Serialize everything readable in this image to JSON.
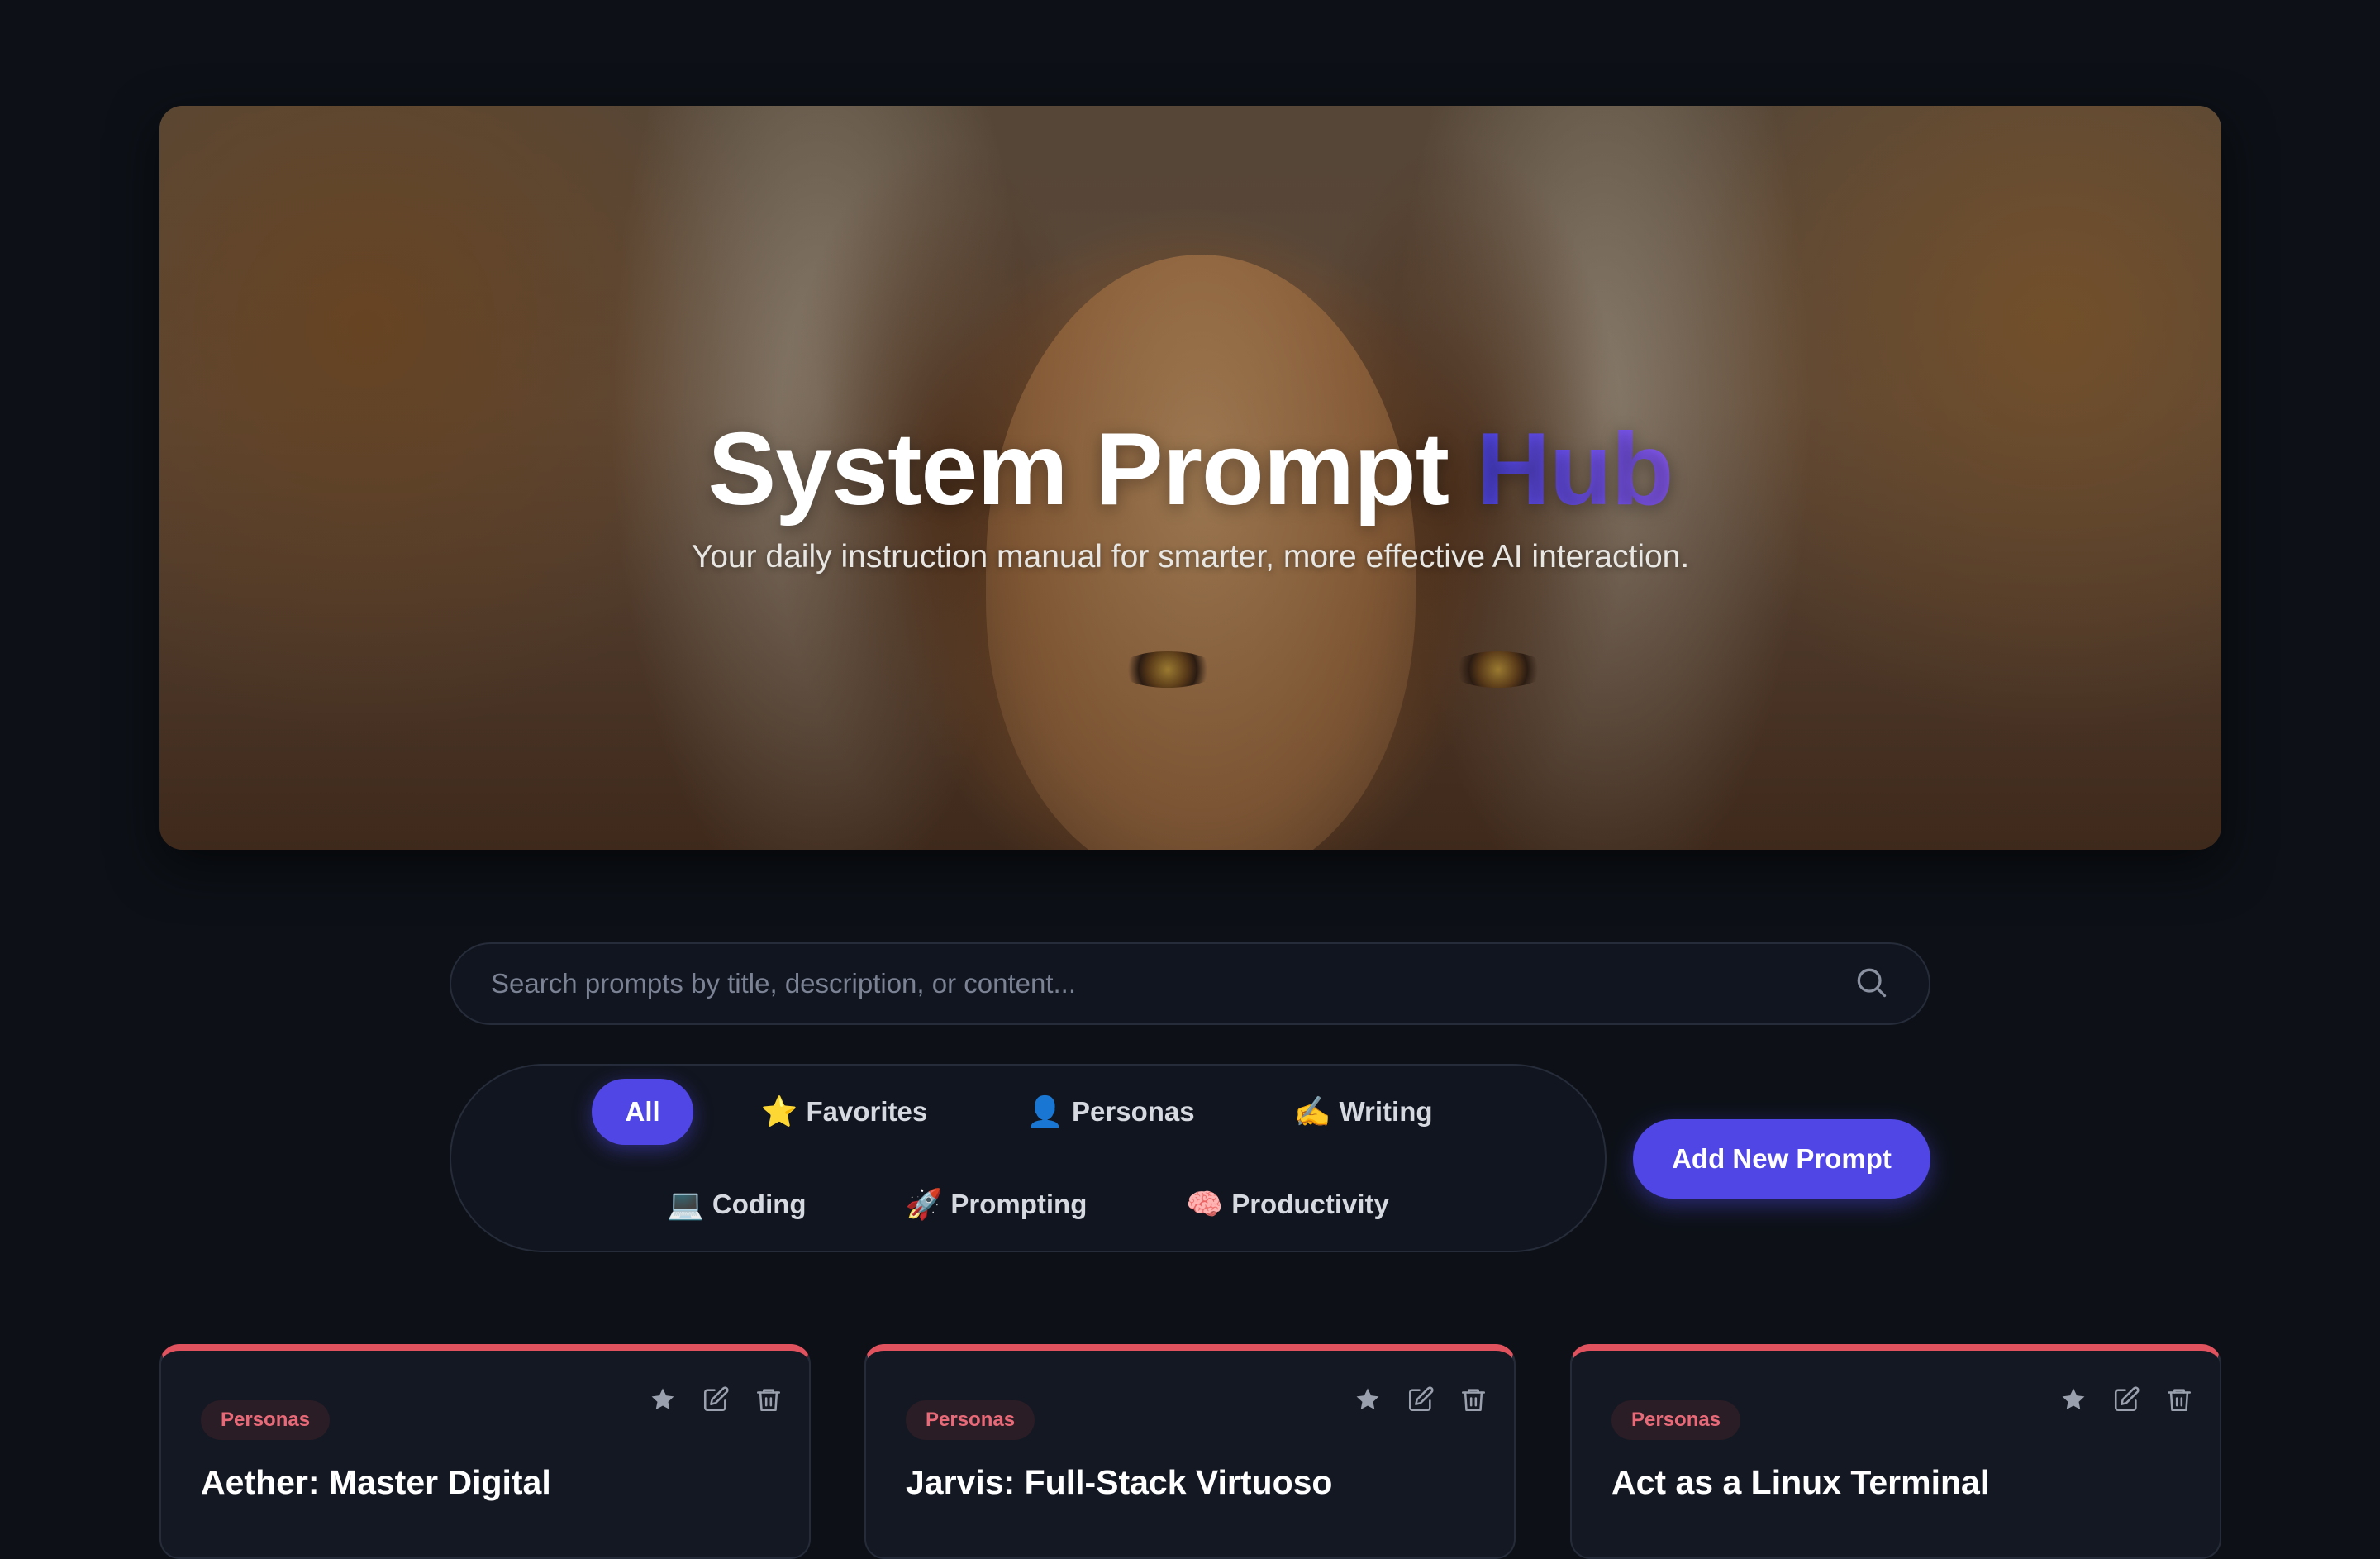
{
  "hero": {
    "title_main": "System Prompt",
    "title_accent": "Hub",
    "subtitle": "Your daily instruction manual for smarter, more effective AI interaction."
  },
  "search": {
    "placeholder": "Search prompts by title, description, or content...",
    "value": ""
  },
  "filters": [
    {
      "label": "All",
      "emoji": "",
      "active": true
    },
    {
      "label": "Favorites",
      "emoji": "⭐"
    },
    {
      "label": "Personas",
      "emoji": "👤"
    },
    {
      "label": "Writing",
      "emoji": "✍️"
    },
    {
      "label": "Coding",
      "emoji": "💻"
    },
    {
      "label": "Prompting",
      "emoji": "🚀"
    },
    {
      "label": "Productivity",
      "emoji": "🧠"
    }
  ],
  "add_button": "Add New Prompt",
  "cards": [
    {
      "category": "Personas",
      "title": "Aether: Master Digital"
    },
    {
      "category": "Personas",
      "title": "Jarvis: Full-Stack Virtuoso"
    },
    {
      "category": "Personas",
      "title": "Act as a Linux Terminal"
    }
  ],
  "colors": {
    "accent": "#4f46e5",
    "card_border_top": "#e0525e",
    "badge_text": "#e86a78",
    "background": "#0d1117"
  },
  "icons": {
    "search": "search-icon",
    "favorite": "star-icon",
    "edit": "edit-icon",
    "delete": "trash-icon"
  }
}
